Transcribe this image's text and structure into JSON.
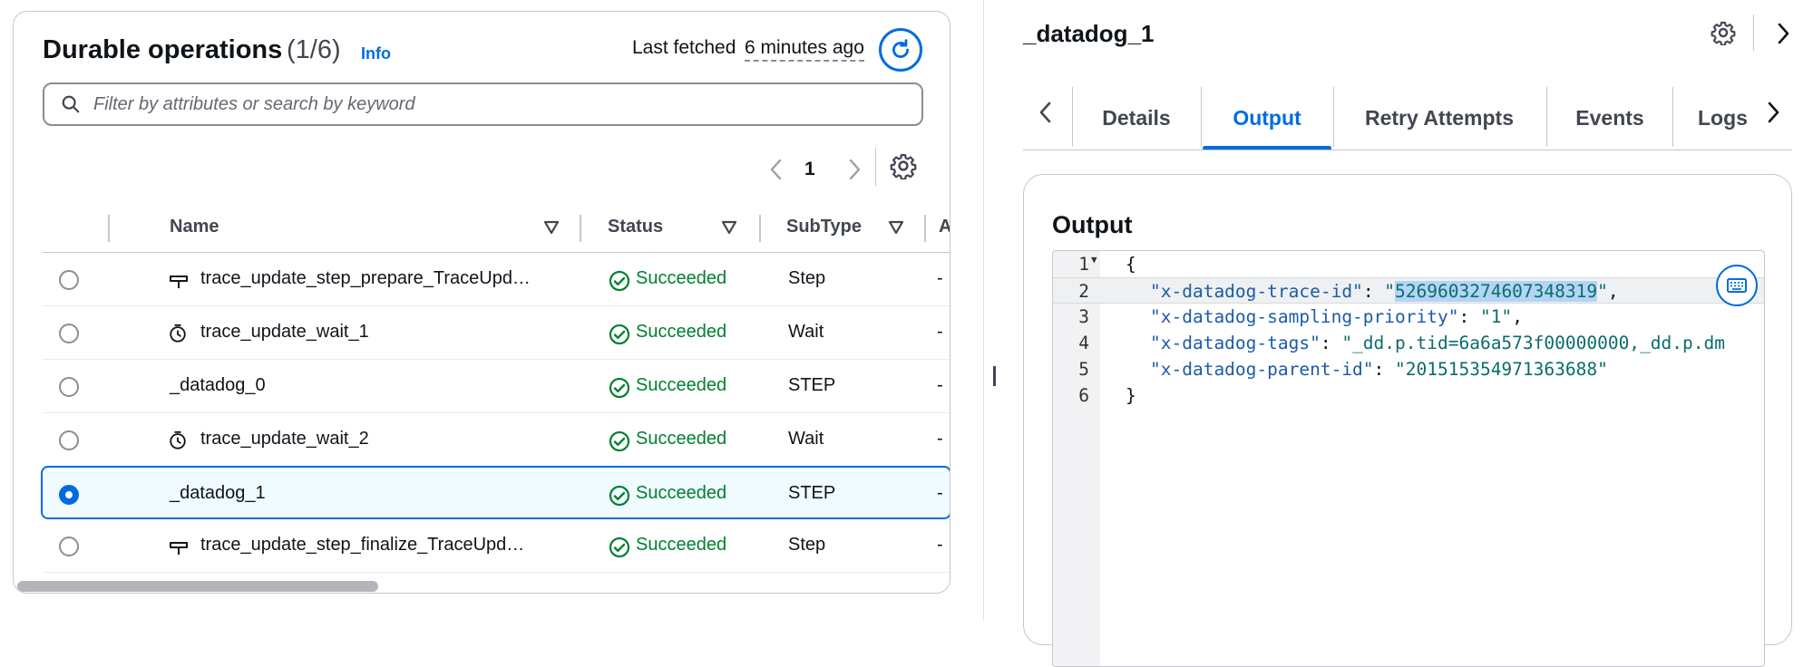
{
  "left_panel": {
    "title": "Durable operations",
    "count": "(1/6)",
    "info_link": "Info",
    "last_fetched_label": "Last fetched",
    "last_fetched_ago": "6 minutes ago",
    "search_placeholder": "Filter by attributes or search by keyword",
    "pagination": {
      "current_page": "1"
    },
    "columns": [
      "Name",
      "Status",
      "SubType",
      "A"
    ],
    "rows": [
      {
        "name": "trace_update_step_prepare_TraceUpd…",
        "icon": "step-icon",
        "status": "Succeeded",
        "subtype": "Step",
        "extra": "-",
        "selected": false
      },
      {
        "name": "trace_update_wait_1",
        "icon": "timer-icon",
        "status": "Succeeded",
        "subtype": "Wait",
        "extra": "-",
        "selected": false
      },
      {
        "name": "_datadog_0",
        "icon": "",
        "status": "Succeeded",
        "subtype": "STEP",
        "extra": "-",
        "selected": false
      },
      {
        "name": "trace_update_wait_2",
        "icon": "timer-icon",
        "status": "Succeeded",
        "subtype": "Wait",
        "extra": "-",
        "selected": false
      },
      {
        "name": "_datadog_1",
        "icon": "",
        "status": "Succeeded",
        "subtype": "STEP",
        "extra": "-",
        "selected": true
      },
      {
        "name": "trace_update_step_finalize_TraceUpd…",
        "icon": "step-icon",
        "status": "Succeeded",
        "subtype": "Step",
        "extra": "-",
        "selected": false
      }
    ]
  },
  "right_panel": {
    "title": "_datadog_1",
    "tabs": [
      {
        "label": "Details",
        "active": false
      },
      {
        "label": "Output",
        "active": true
      },
      {
        "label": "Retry Attempts",
        "active": false
      },
      {
        "label": "Events",
        "active": false
      },
      {
        "label": "Logs",
        "active": false
      }
    ],
    "output_heading": "Output",
    "editor": {
      "line_numbers": [
        "1",
        "2",
        "3",
        "4",
        "5",
        "6"
      ],
      "open_brace": "{",
      "close_brace": "}",
      "entries": [
        {
          "key": "\"x-datadog-trace-id\"",
          "value_prefix": "\"",
          "value_selected": "5269603274607348319",
          "value_suffix": "\"",
          "comma": ","
        },
        {
          "key": "\"x-datadog-sampling-priority\"",
          "value": "\"1\"",
          "comma": ","
        },
        {
          "key": "\"x-datadog-tags\"",
          "value": "\"_dd.p.tid=6a6a573f00000000,_dd.p.dm",
          "comma": ""
        },
        {
          "key": "\"x-datadog-parent-id\"",
          "value": "\"201515354971363688\"",
          "comma": ""
        }
      ]
    }
  },
  "colors": {
    "accent": "#006ce0",
    "success": "#00802f",
    "border": "#c6c6cd"
  }
}
